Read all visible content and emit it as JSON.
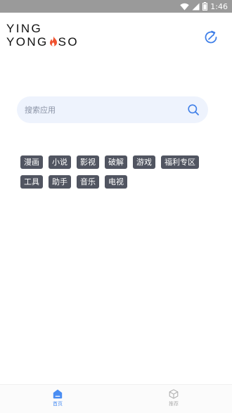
{
  "status_bar": {
    "time": "1:46"
  },
  "logo": {
    "line1": "YING",
    "line2_a": "YONG",
    "line2_b": "SO"
  },
  "search": {
    "placeholder": "搜索应用"
  },
  "tags": [
    "漫画",
    "小说",
    "影视",
    "破解",
    "游戏",
    "福利专区",
    "工具",
    "助手",
    "音乐",
    "电视"
  ],
  "bottom_nav": {
    "home_label": "首页",
    "recommend_label": "推荐"
  },
  "colors": {
    "accent": "#4a8df2",
    "tag_bg": "#515561",
    "search_bg": "#eef3fd",
    "flame": "#f0522f"
  }
}
